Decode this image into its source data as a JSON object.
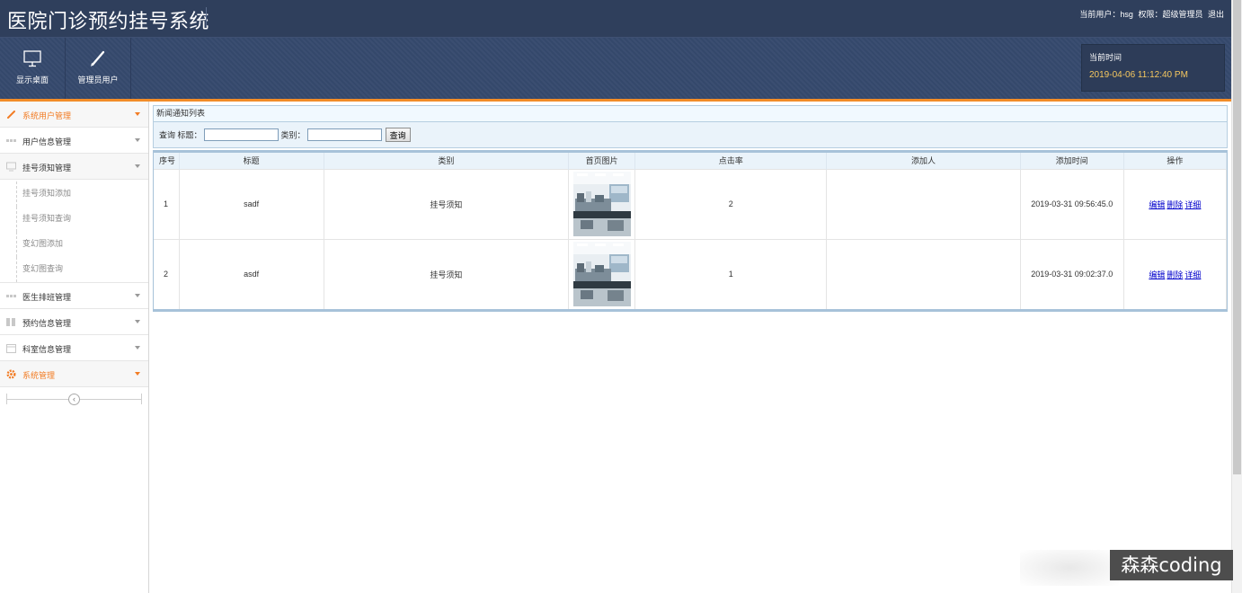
{
  "header": {
    "title": "医院门诊预约挂号系统",
    "user_label": "当前用户：hsg",
    "role_label": "权限：超级管理员",
    "logout": "退出"
  },
  "toolbar": {
    "desktop_label": "显示桌面",
    "admin_label": "管理员用户"
  },
  "clock": {
    "label": "当前时间",
    "value": "2019-04-06 11:12:40 PM"
  },
  "sidebar": {
    "groups": [
      {
        "label": "系统用户管理"
      },
      {
        "label": "用户信息管理"
      },
      {
        "label": "挂号须知管理"
      },
      {
        "label": "医生排班管理"
      },
      {
        "label": "预约信息管理"
      },
      {
        "label": "科室信息管理"
      },
      {
        "label": "系统管理"
      }
    ],
    "sub_items": [
      "挂号须知添加",
      "挂号须知查询",
      "变幻图添加",
      "变幻图查询"
    ]
  },
  "panel": {
    "title": "新闻通知列表",
    "search_prefix": "查询 标题：",
    "category_label": "类别：",
    "title_value": "",
    "category_value": "",
    "search_button": "查询"
  },
  "table": {
    "headers": [
      "序号",
      "标题",
      "类别",
      "首页图片",
      "点击率",
      "添加人",
      "添加时间",
      "操作"
    ],
    "rows": [
      {
        "no": "1",
        "title": "sadf",
        "category": "挂号须知",
        "clicks": "2",
        "adder": "",
        "time": "2019-03-31 09:56:45.0"
      },
      {
        "no": "2",
        "title": "asdf",
        "category": "挂号须知",
        "clicks": "1",
        "adder": "",
        "time": "2019-03-31 09:02:37.0"
      }
    ],
    "actions": {
      "edit": "编辑",
      "delete": "删除",
      "detail": "详细"
    }
  },
  "watermark": "森森coding"
}
